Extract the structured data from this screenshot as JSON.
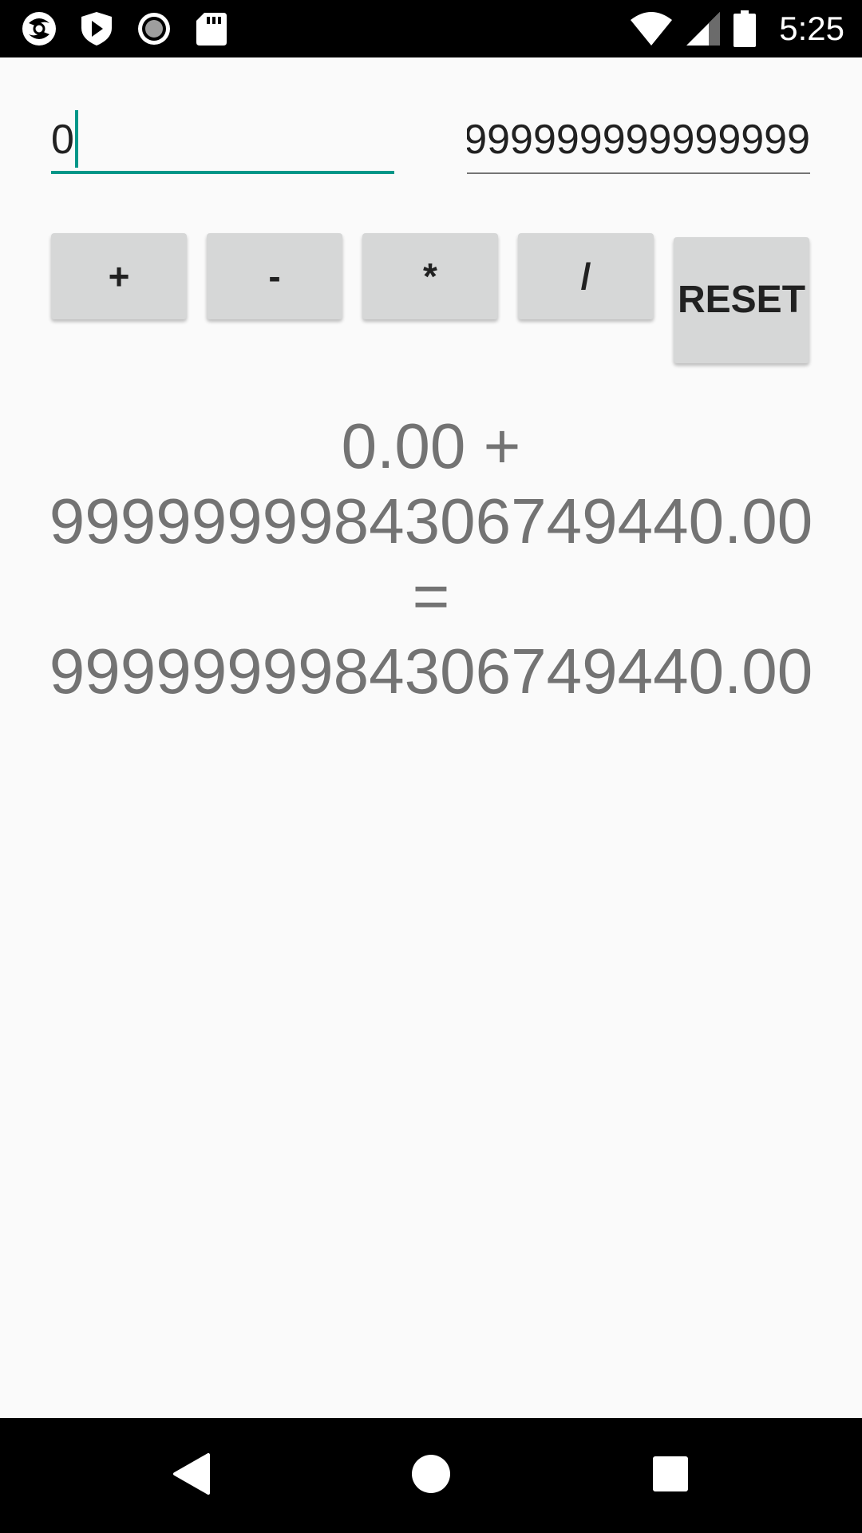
{
  "status_bar": {
    "time": "5:25",
    "left_icons": [
      "app-logo-icon",
      "shield-play-icon",
      "record-icon",
      "sd-card-icon"
    ],
    "right_icons": [
      "wifi-icon",
      "cell-signal-icon",
      "battery-icon"
    ]
  },
  "inputs": {
    "first": {
      "value": "0"
    },
    "second": {
      "value": "9999999999999999"
    }
  },
  "buttons": {
    "add": "+",
    "subtract": "-",
    "multiply": "*",
    "divide": "/",
    "reset": "RESET"
  },
  "result": {
    "text": "0.00 + 9999999984306749440.00 = 9999999984306749440.00"
  },
  "colors": {
    "accent": "#009688",
    "button_bg": "#d6d7d7",
    "result_text": "#737373",
    "background": "#fafafa"
  },
  "nav_bar": {
    "buttons": [
      "back-icon",
      "home-icon",
      "recents-icon"
    ]
  }
}
